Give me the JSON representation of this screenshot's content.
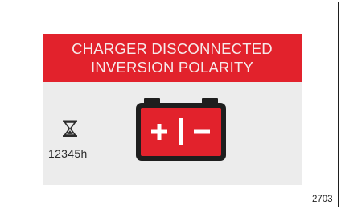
{
  "alert": {
    "line1": "CHARGER DISCONNECTED",
    "line2": "INVERSION POLARITY",
    "color": "#e2222c"
  },
  "status": {
    "hours_value": "12345",
    "hours_unit": "h"
  },
  "battery": {
    "icon": "battery-polarity-icon",
    "plus_symbol": "+",
    "minus_symbol": "-",
    "fill_color": "#e2222c"
  },
  "hourglass": {
    "icon": "hourglass-icon"
  },
  "figure": {
    "code": "2703"
  }
}
